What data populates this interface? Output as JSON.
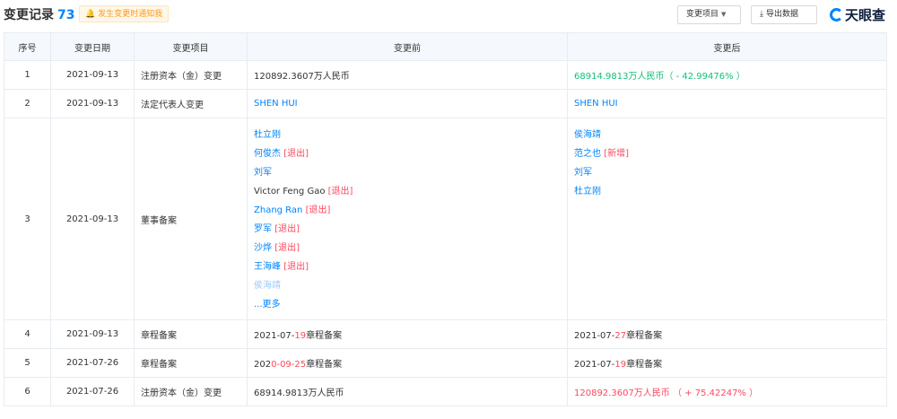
{
  "header": {
    "title": "变更记录",
    "count": "73",
    "notify_label": "发生变更时通知我",
    "filter_label": "变更项目",
    "export_label": "导出数据",
    "logo_text": "天眼查"
  },
  "colors": {
    "accent": "#0084ff",
    "increase_green": "#13c07a",
    "highlight_red": "#fd485e",
    "header_bg": "#f5f8fd",
    "notify_bg": "#fff7e8"
  },
  "table": {
    "columns": [
      "序号",
      "变更日期",
      "变更项目",
      "变更前",
      "变更后"
    ],
    "rows": [
      {
        "idx": "1",
        "date": "2021-09-13",
        "item": "注册资本（金）变更",
        "before": "120892.3607万人民币",
        "after": "68914.9813万人民币（ - 42.99476% ）"
      },
      {
        "idx": "2",
        "date": "2021-09-13",
        "item": "法定代表人变更",
        "before": "SHEN HUI",
        "after": "SHEN HUI"
      },
      {
        "idx": "3",
        "date": "2021-09-13",
        "item": "董事备案",
        "before_list": [
          {
            "name": "杜立刚",
            "tag": ""
          },
          {
            "name": "何俊杰",
            "tag": "[退出]"
          },
          {
            "name": "刘军",
            "tag": ""
          },
          {
            "name": "Victor Feng Gao",
            "tag": "[退出]"
          },
          {
            "name": "Zhang Ran",
            "tag": "[退出]"
          },
          {
            "name": "罗军",
            "tag": "[退出]"
          },
          {
            "name": "沙烨",
            "tag": "[退出]"
          },
          {
            "name": "王海峰",
            "tag": "[退出]"
          },
          {
            "name": "侯海靖",
            "tag": ""
          }
        ],
        "more_label": "...更多",
        "after_list": [
          {
            "name": "侯海靖",
            "tag": ""
          },
          {
            "name": "范之也",
            "tag": "[新增]"
          },
          {
            "name": "刘军",
            "tag": ""
          },
          {
            "name": "杜立刚",
            "tag": ""
          }
        ]
      },
      {
        "idx": "4",
        "date": "2021-09-13",
        "item": "章程备案",
        "before_a": "2021-07-",
        "before_b": "19",
        "before_c": "章程备案",
        "after_a": "2021-07-",
        "after_b": "27",
        "after_c": "章程备案"
      },
      {
        "idx": "5",
        "date": "2021-07-26",
        "item": "章程备案",
        "before_a": "202",
        "before_b": "0-09-25",
        "before_c": "章程备案",
        "after_a": "2021-07-",
        "after_b": "19",
        "after_c": "章程备案"
      },
      {
        "idx": "6",
        "date": "2021-07-26",
        "item": "注册资本（金）变更",
        "before": "68914.9813万人民币",
        "after": "120892.3607万人民币 （ + 75.42247% ）"
      }
    ]
  }
}
